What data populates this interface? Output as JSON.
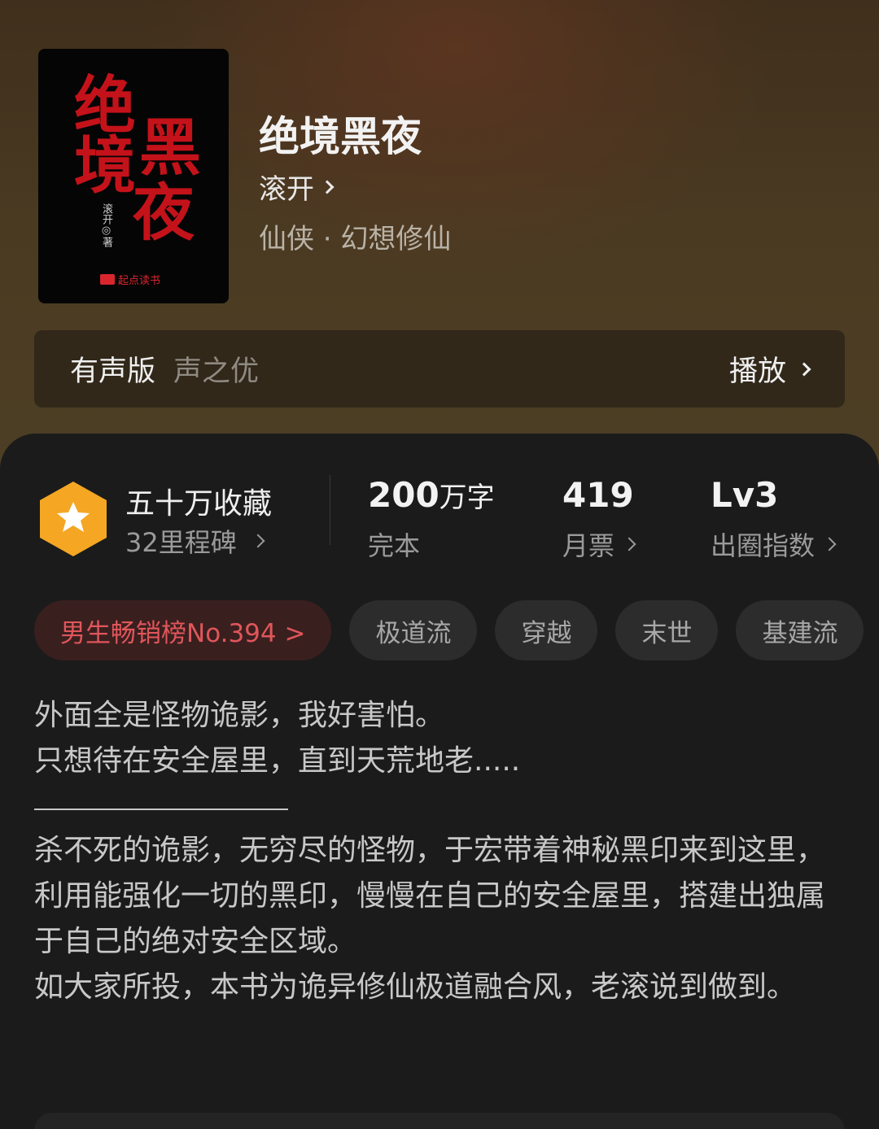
{
  "book": {
    "title": "绝境黑夜",
    "author": "滚开",
    "genre": "仙侠 · 幻想修仙",
    "cover": {
      "title_chars": [
        "绝",
        "境",
        "黑",
        "夜"
      ],
      "author_line": "滚开◎著",
      "publisher": "起点读书",
      "title_color": "#c4121a"
    }
  },
  "audio": {
    "label": "有声版",
    "narrator": "声之优",
    "play_label": "播放"
  },
  "stats": {
    "collection": {
      "main": "五十万收藏",
      "sub": "32里程碑"
    },
    "words": {
      "number": "200",
      "unit": "万字",
      "label": "完本"
    },
    "monthly": {
      "number": "419",
      "label": "月票"
    },
    "index": {
      "number": "Lv3",
      "label": "出圈指数"
    }
  },
  "tags": [
    "男生畅销榜No.394 >",
    "极道流",
    "穿越",
    "末世",
    "基建流"
  ],
  "synopsis": {
    "intro_lines": [
      "外面全是怪物诡影，我好害怕。",
      "只想待在安全屋里，直到天荒地老....."
    ],
    "paragraphs": [
      "杀不死的诡影，无穷尽的怪物，于宏带着神秘黑印来到这里，利用能强化一切的黑印，慢慢在自己的安全屋里，搭建出独属于自己的绝对安全区域。",
      "如大家所投，本书为诡异修仙极道融合风，老滚说到做到。"
    ]
  },
  "colors": {
    "rank_tag_text": "#e0565a",
    "badge": "#f5a623"
  }
}
